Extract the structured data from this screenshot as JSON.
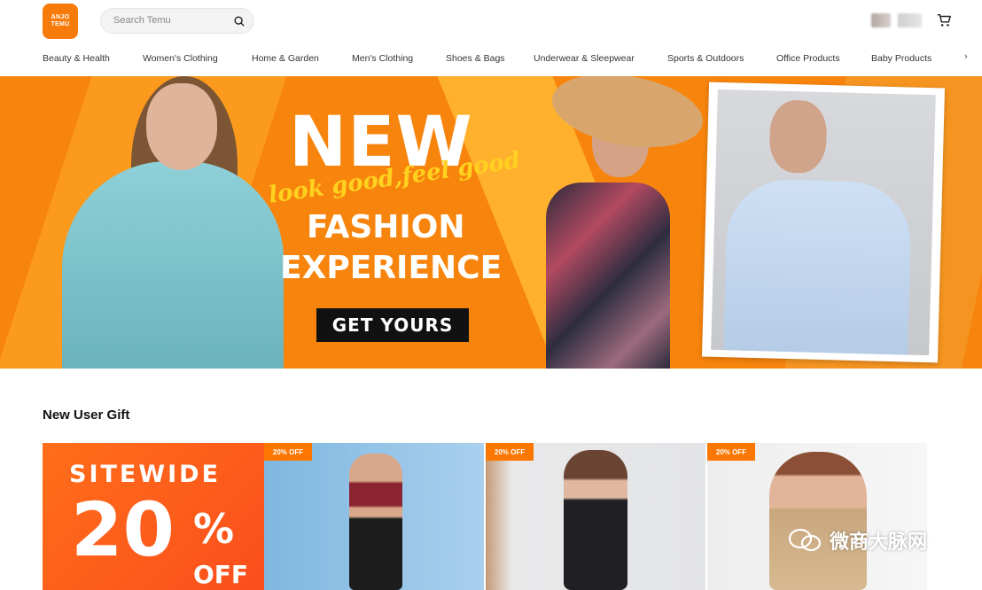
{
  "header": {
    "logo_line1": "ANJO",
    "logo_line2": "TEMU",
    "search_placeholder": "Search Temu"
  },
  "categories": [
    "Beauty & Health",
    "Women's Clothing",
    "Home & Garden",
    "Men's Clothing",
    "Shoes & Bags",
    "Underwear & Sleepwear",
    "Sports & Outdoors",
    "Office Products",
    "Baby Products"
  ],
  "banner": {
    "headline_new": "NEW",
    "headline_script": "look good,feel good",
    "headline_fashion": "FASHION",
    "headline_experience": "EXPERIENCE",
    "cta": "GET YOURS"
  },
  "section": {
    "title": "New User Gift"
  },
  "gift_promo": {
    "line1": "SITEWIDE",
    "percent": "20",
    "percent_sign": "%",
    "off": "OFF"
  },
  "gift_items": [
    {
      "badge": "20% OFF"
    },
    {
      "badge": "20% OFF"
    },
    {
      "badge": "20% OFF"
    }
  ],
  "watermark": "微商大脉网",
  "colors": {
    "brand_orange": "#f77b0a",
    "banner_orange": "#f7840c",
    "cta_black": "#111111"
  }
}
